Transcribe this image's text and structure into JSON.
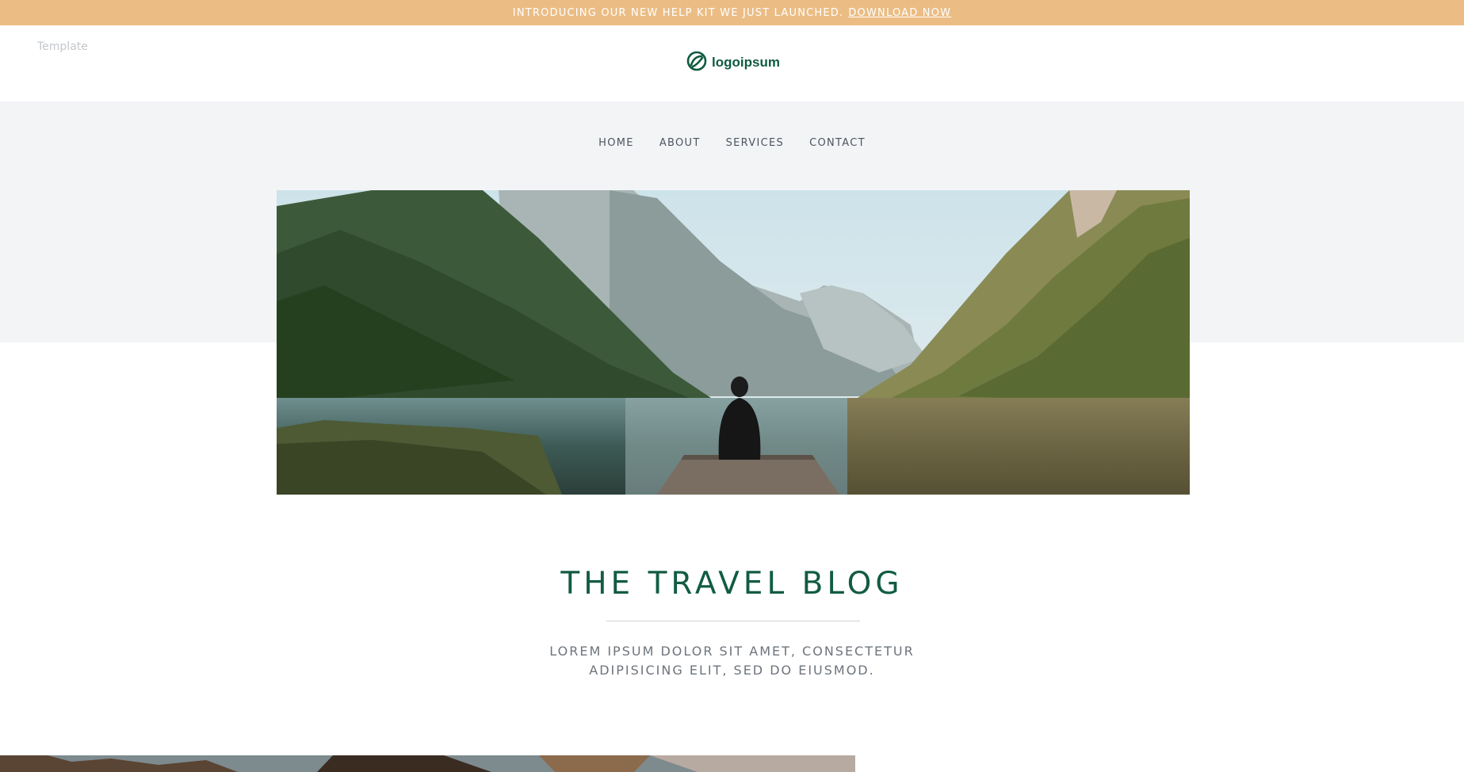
{
  "announcement": {
    "text": "INTRODUCING OUR NEW HELP KIT WE JUST LAUNCHED.",
    "link_label": "DOWNLOAD NOW"
  },
  "header": {
    "template_label": "Template",
    "logo_text": "logoipsum"
  },
  "nav": {
    "items": [
      {
        "label": "HOME"
      },
      {
        "label": "ABOUT"
      },
      {
        "label": "SERVICES"
      },
      {
        "label": "CONTACT"
      }
    ]
  },
  "hero": {
    "image": "mountain-lake-person-on-dock"
  },
  "blog": {
    "title": "THE TRAVEL BLOG",
    "subtitle_line1": "LOREM IPSUM DOLOR SIT AMET, CONSECTETUR",
    "subtitle_line2": "ADIPISICING ELIT, SED DO EIUSMOD."
  },
  "colors": {
    "announcement_bg": "#ebbd85",
    "brand_green": "#125c42",
    "band_grey": "#f2f4f6"
  }
}
